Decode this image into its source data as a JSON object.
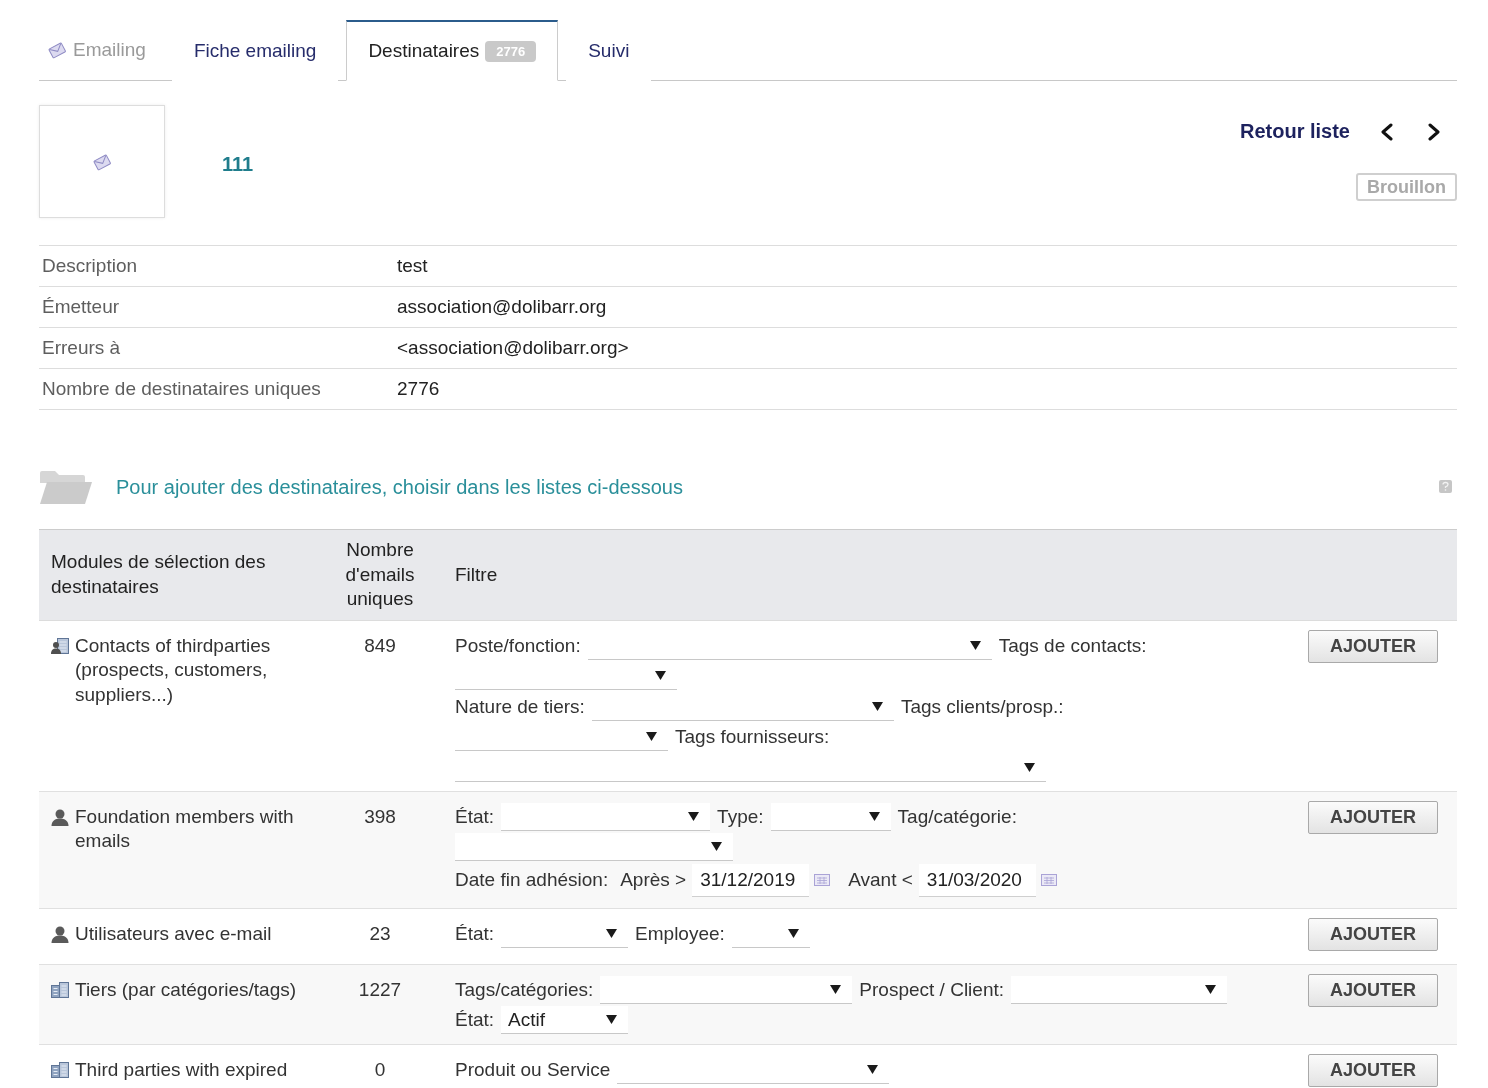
{
  "tabs": [
    {
      "label": "Emailing",
      "kind": "title",
      "selected": false
    },
    {
      "label": "Fiche emailing",
      "kind": "tab",
      "selected": false
    },
    {
      "label": "Destinataires",
      "kind": "tab",
      "selected": true,
      "badge": "2776"
    },
    {
      "label": "Suivi",
      "kind": "tab",
      "selected": false
    }
  ],
  "record": {
    "ref": "111",
    "back_link": "Retour liste",
    "status": "Brouillon"
  },
  "fields": [
    {
      "label": "Description",
      "value": "test"
    },
    {
      "label": "Émetteur",
      "value": "association@dolibarr.org"
    },
    {
      "label": "Erreurs à",
      "value": "<association@dolibarr.org>"
    },
    {
      "label": "Nombre de destinataires uniques",
      "value": "2776"
    }
  ],
  "section": {
    "title": "Pour ajouter des destinataires, choisir dans les listes ci-dessous"
  },
  "table": {
    "columns": [
      "Modules de sélection des destinataires",
      "Nombre d'emails uniques",
      "Filtre"
    ],
    "rows": [
      {
        "kind": "contacts",
        "module": "Contacts of thirdparties (prospects, customers, suppliers...)",
        "count": "849",
        "filters": [
          {
            "kind": "select",
            "label": "Poste/fonction:"
          },
          {
            "kind": "select",
            "label": "Tags de contacts:"
          },
          {
            "kind": "select",
            "label": "Nature de tiers:"
          },
          {
            "kind": "select",
            "label": "Tags clients/prosp.:"
          },
          {
            "kind": "select",
            "label": "Tags fournisseurs:"
          }
        ],
        "button": "AJOUTER"
      },
      {
        "kind": "members",
        "module": "Foundation members with emails",
        "count": "398",
        "filters": [
          {
            "kind": "select",
            "label": "État:"
          },
          {
            "kind": "select",
            "label": "Type:"
          },
          {
            "kind": "select",
            "label": "Tag/catégorie:"
          },
          {
            "kind": "date_range",
            "label": "Date fin adhésion:",
            "from_label": "Après >",
            "from_value": "31/12/2019",
            "to_label": "Avant <",
            "to_value": "31/03/2020"
          }
        ],
        "button": "AJOUTER"
      },
      {
        "kind": "users",
        "module": "Utilisateurs avec e-mail",
        "count": "23",
        "filters": [
          {
            "kind": "select",
            "label": "État:"
          },
          {
            "kind": "select",
            "label": "Employee:"
          }
        ],
        "button": "AJOUTER"
      },
      {
        "kind": "thirdparties",
        "module": "Tiers (par catégories/tags)",
        "count": "1227",
        "filters": [
          {
            "kind": "select",
            "label": "Tags/catégories:"
          },
          {
            "kind": "select",
            "label": "Prospect / Client:"
          },
          {
            "kind": "select",
            "label": "État:",
            "value": "Actif"
          }
        ],
        "button": "AJOUTER"
      },
      {
        "kind": "thirdparties",
        "module": "Third parties with expired",
        "count": "0",
        "filters": [
          {
            "kind": "select",
            "label": "Produit ou Service"
          }
        ],
        "button": "AJOUTER"
      }
    ]
  }
}
